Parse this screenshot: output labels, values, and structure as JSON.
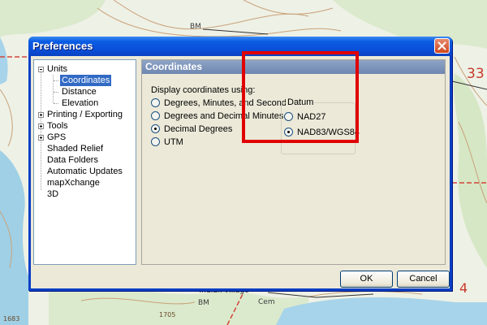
{
  "map": {
    "labels": {
      "section_33": "33",
      "section_4": "4",
      "bm_top": "BM",
      "bm_bottom": "BM",
      "cem": "Cem",
      "elev_1705": "1705",
      "elev_1683": "1683",
      "village": "Indian Village"
    },
    "colors": {
      "water": "#9fd0e6",
      "road": "#d4453a",
      "contour": "#c9a27a",
      "woods": "#d9e8cb"
    }
  },
  "window": {
    "title": "Preferences",
    "close_icon": "close-icon"
  },
  "tree": {
    "items": [
      {
        "label": "Units",
        "expander": "minus"
      },
      {
        "label": "Coordinates",
        "selected": true
      },
      {
        "label": "Distance"
      },
      {
        "label": "Elevation"
      },
      {
        "label": "Printing / Exporting",
        "expander": "plus"
      },
      {
        "label": "Tools",
        "expander": "plus"
      },
      {
        "label": "GPS",
        "expander": "plus"
      },
      {
        "label": "Shaded Relief"
      },
      {
        "label": "Data Folders"
      },
      {
        "label": "Automatic Updates"
      },
      {
        "label": "mapXchange"
      },
      {
        "label": "3D"
      }
    ]
  },
  "panel": {
    "title": "Coordinates",
    "display_label": "Display coordinates using:",
    "format_options": [
      {
        "label": "Degrees, Minutes, and Seconds",
        "checked": false
      },
      {
        "label": "Degrees and Decimal Minutes",
        "checked": false
      },
      {
        "label": "Decimal Degrees",
        "checked": true
      },
      {
        "label": "UTM",
        "checked": false
      }
    ],
    "datum": {
      "legend": "Datum",
      "options": [
        {
          "label": "NAD27",
          "checked": false
        },
        {
          "label": "NAD83/WGS84",
          "checked": true
        }
      ]
    },
    "highlight_color": "#e00000"
  },
  "buttons": {
    "ok": "OK",
    "cancel": "Cancel"
  }
}
